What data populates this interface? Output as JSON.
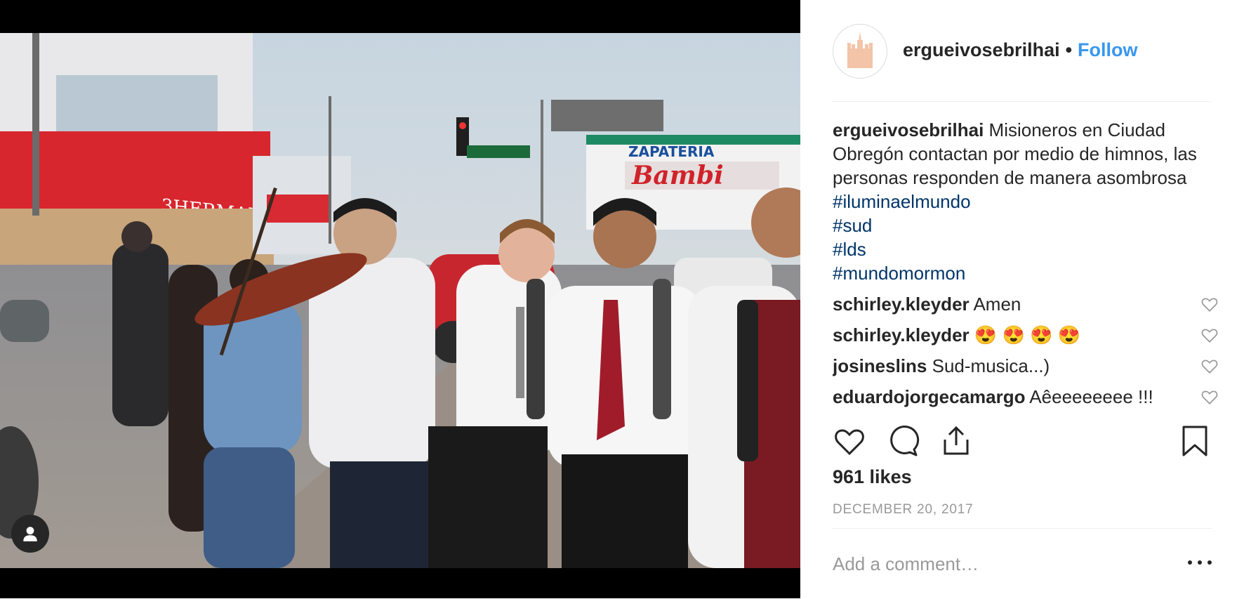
{
  "post": {
    "username": "ergueivosebrilhai",
    "separator": "•",
    "follow_label": "Follow",
    "caption_user": "ergueivosebrilhai",
    "caption_text": " Misioneros en Ciudad Obregón contactan por medio de himnos, las personas responden de manera asombrosa ",
    "hashtags": [
      "#iluminaelmundo",
      "#sud",
      "#lds",
      "#mundomormon"
    ],
    "store_sign_1": "3HERMANOS",
    "store_sign_2": "ZAPATERIA",
    "store_sign_3": "Bambi"
  },
  "comments": [
    {
      "user": "schirley.kleyder",
      "text": " Amen"
    },
    {
      "user": "schirley.kleyder",
      "text": " 😍 😍 😍 😍"
    },
    {
      "user": "josineslins",
      "text": " Sud-musica...)"
    },
    {
      "user": "eduardojorgecamargo",
      "text": " Aêeeeeeeee !!!"
    }
  ],
  "likes": "961 likes",
  "date": "DECEMBER 20, 2017",
  "add_comment_placeholder": "Add a comment…",
  "icons": {
    "like": "heart-icon",
    "comment": "comment-icon",
    "share": "share-icon",
    "save": "bookmark-icon",
    "more": "more-icon",
    "tag": "person-icon"
  },
  "colors": {
    "link": "#3897f0",
    "hashtag": "#003569",
    "text": "#262626",
    "muted": "#999999"
  }
}
